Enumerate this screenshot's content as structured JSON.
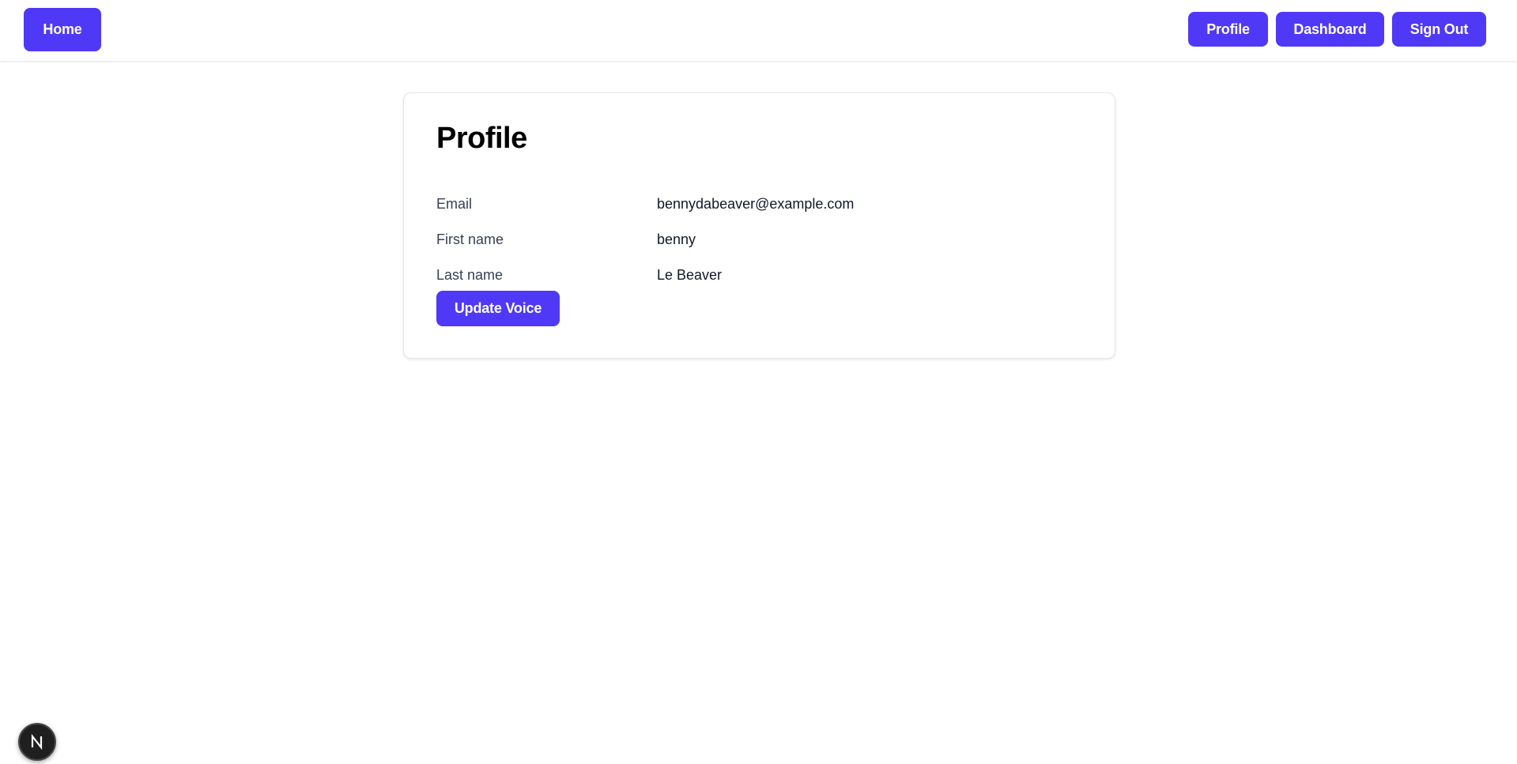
{
  "nav": {
    "home_label": "Home",
    "profile_label": "Profile",
    "dashboard_label": "Dashboard",
    "signout_label": "Sign Out"
  },
  "profile": {
    "title": "Profile",
    "fields": [
      {
        "label": "Email",
        "value": "bennydabeaver@example.com"
      },
      {
        "label": "First name",
        "value": "benny"
      },
      {
        "label": "Last name",
        "value": "Le Beaver"
      }
    ],
    "update_button_label": "Update Voice"
  },
  "dev_indicator": {
    "icon": "nextjs-icon",
    "letter": "N"
  },
  "colors": {
    "accent": "#4f39f6",
    "background": "#ffffff",
    "badge_bg": "#1f1f1f"
  }
}
